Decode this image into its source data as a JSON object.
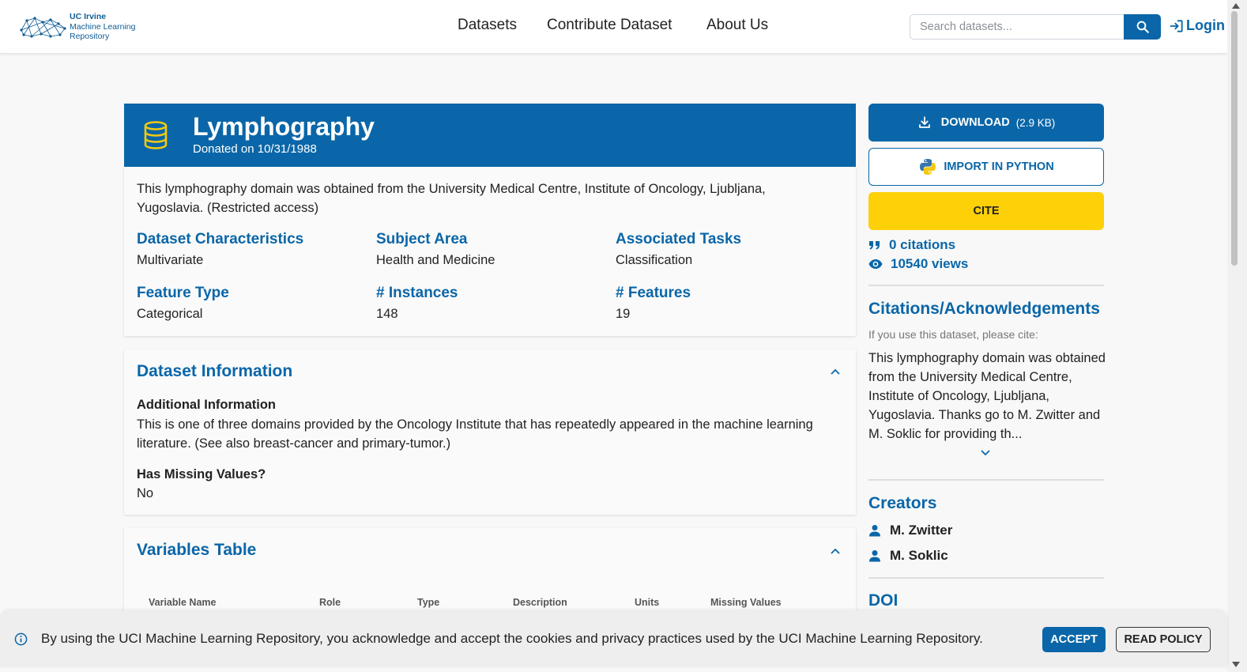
{
  "header": {
    "logo_lines": [
      "UC Irvine",
      "Machine Learning",
      "Repository"
    ],
    "nav": [
      {
        "label": "Datasets"
      },
      {
        "label": "Contribute Dataset"
      },
      {
        "label": "About Us"
      }
    ],
    "search_placeholder": "Search datasets...",
    "login_label": "Login"
  },
  "dataset": {
    "title": "Lymphography",
    "donated": "Donated on 10/31/1988",
    "description": "This lymphography domain was obtained from the University Medical Centre, Institute of Oncology, Ljubljana, Yugoslavia. (Restricted access)",
    "properties": [
      {
        "label": "Dataset Characteristics",
        "value": "Multivariate"
      },
      {
        "label": "Subject Area",
        "value": "Health and Medicine"
      },
      {
        "label": "Associated Tasks",
        "value": "Classification"
      },
      {
        "label": "Feature Type",
        "value": "Categorical"
      },
      {
        "label": "# Instances",
        "value": "148"
      },
      {
        "label": "# Features",
        "value": "19"
      }
    ]
  },
  "info_panel": {
    "title": "Dataset Information",
    "additional_label": "Additional Information",
    "additional_text": "This is one of three domains provided by the Oncology Institute that has repeatedly appeared in the machine learning literature. (See also breast-cancer and primary-tumor.)",
    "missing_label": "Has Missing Values?",
    "missing_value": "No"
  },
  "variables_panel": {
    "title": "Variables Table",
    "columns": [
      "Variable Name",
      "Role",
      "Type",
      "Description",
      "Units",
      "Missing Values"
    ]
  },
  "sidebar": {
    "download_label": "DOWNLOAD",
    "download_size": "(2.9 KB)",
    "python_label": "IMPORT IN PYTHON",
    "cite_label": "CITE",
    "citations": "0 citations",
    "views": "10540 views",
    "citations_title": "Citations/Acknowledgements",
    "cite_hint": "If you use this dataset, please cite:",
    "cite_text": "This lymphography domain was obtained from the University Medical Centre, Institute of Oncology, Ljubljana, Yugoslavia. Thanks go to M. Zwitter and M. Soklic for providing th...",
    "creators_title": "Creators",
    "creators": [
      "M. Zwitter",
      "M. Soklic"
    ],
    "doi_title": "DOI"
  },
  "cookie": {
    "text": "By using the UCI Machine Learning Repository, you acknowledge and accept the cookies and privacy practices used by the UCI Machine Learning Repository.",
    "accept_label": "ACCEPT",
    "policy_label": "READ POLICY"
  },
  "colors": {
    "primary": "#0a66a8",
    "cite_yellow": "#fdd008",
    "icon_yellow": "#f2c811"
  }
}
